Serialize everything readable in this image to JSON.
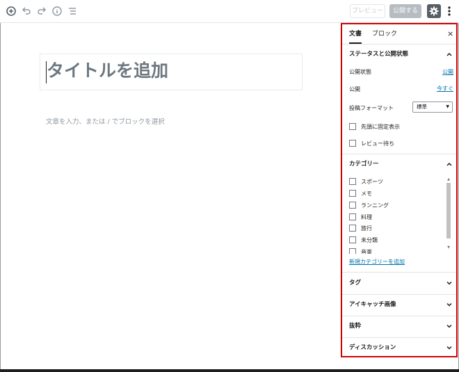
{
  "toolbar": {
    "preview_label": "プレビュー",
    "publish_label": "公開する"
  },
  "editor": {
    "title_placeholder": "タイトルを追加",
    "body_placeholder": "文章を入力、または / でブロックを選択"
  },
  "sidebar": {
    "tabs": [
      {
        "label": "文書",
        "active": true
      },
      {
        "label": "ブロック",
        "active": false
      }
    ],
    "close_label": "×",
    "status_panel": {
      "title": "ステータスと公開状態",
      "visibility_label": "公開状態",
      "visibility_value": "公開",
      "publish_label": "公開",
      "publish_value": "今すぐ",
      "format_label": "投稿フォーマット",
      "format_value": "標準",
      "sticky_label": "先頭に固定表示",
      "pending_label": "レビュー待ち"
    },
    "category_panel": {
      "title": "カテゴリー",
      "categories": [
        {
          "label": "スポーツ",
          "checked": false
        },
        {
          "label": "メモ",
          "checked": false
        },
        {
          "label": "ランニング",
          "checked": false
        },
        {
          "label": "料理",
          "checked": false
        },
        {
          "label": "旅行",
          "checked": false
        },
        {
          "label": "未分類",
          "checked": false
        },
        {
          "label": "音楽",
          "checked": false
        }
      ],
      "add_new_label": "新規カテゴリーを追加"
    },
    "collapsed_panels": [
      {
        "title": "タグ"
      },
      {
        "title": "アイキャッチ画像"
      },
      {
        "title": "抜粋"
      },
      {
        "title": "ディスカッション"
      }
    ]
  },
  "colors": {
    "highlight_border": "#d00000",
    "link": "#0073aa",
    "settings_active": "#555d66"
  }
}
